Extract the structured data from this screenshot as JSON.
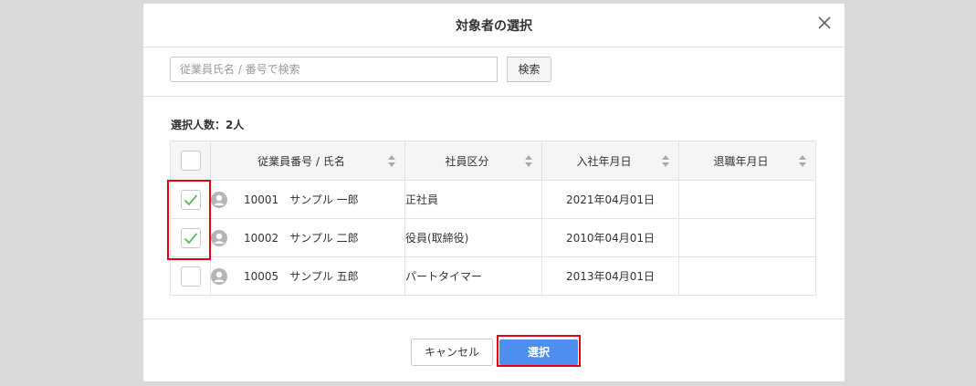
{
  "dialog": {
    "title": "対象者の選択",
    "close_icon": "close-icon"
  },
  "search": {
    "placeholder": "従業員氏名 / 番号で検索",
    "value": "",
    "button_label": "検索"
  },
  "selection": {
    "label": "選択人数：",
    "count": "2人"
  },
  "table": {
    "columns": [
      {
        "label": "従業員番号 / 氏名",
        "sortable": true
      },
      {
        "label": "社員区分",
        "sortable": true
      },
      {
        "label": "入社年月日",
        "sortable": true
      },
      {
        "label": "退職年月日",
        "sortable": true
      }
    ],
    "rows": [
      {
        "checked": true,
        "employee_no": "10001",
        "name": "サンプル 一郎",
        "category": "正社員",
        "hire_date": "2021年04月01日",
        "retire_date": ""
      },
      {
        "checked": true,
        "employee_no": "10002",
        "name": "サンプル 二郎",
        "category": "役員(取締役)",
        "hire_date": "2010年04月01日",
        "retire_date": ""
      },
      {
        "checked": false,
        "employee_no": "10005",
        "name": "サンプル 五郎",
        "category": "パートタイマー",
        "hire_date": "2013年04月01日",
        "retire_date": ""
      }
    ]
  },
  "footer": {
    "cancel_label": "キャンセル",
    "select_label": "選択"
  },
  "colors": {
    "primary": "#4e8ef0",
    "check": "#5cb85c",
    "highlight": "#e50012",
    "backdrop": "#d9d9d9"
  }
}
